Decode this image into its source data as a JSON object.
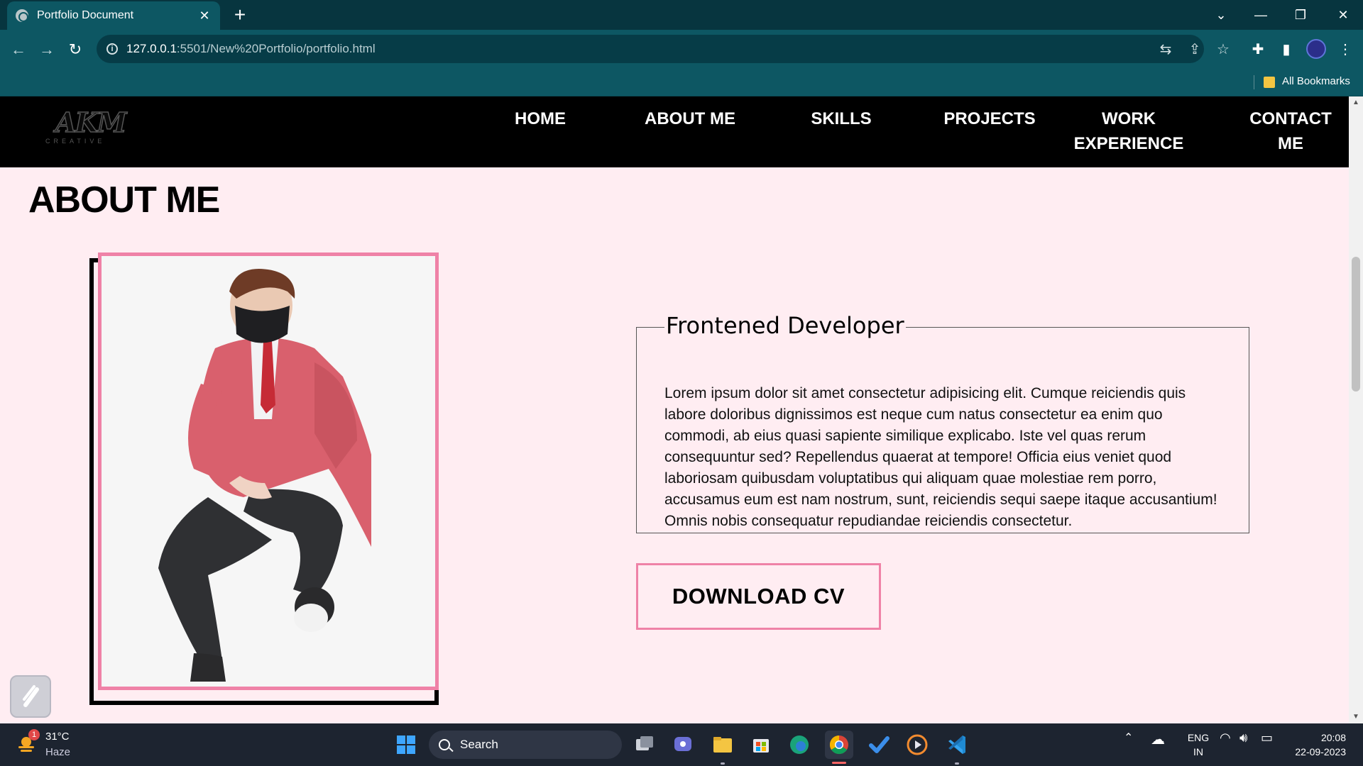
{
  "browser": {
    "tab_title": "Portfolio Document",
    "url_host": "127.0.0.1",
    "url_path": ":5501/New%20Portfolio/portfolio.html",
    "bookmarks_label": "All Bookmarks"
  },
  "site": {
    "logo_text": "AKM",
    "logo_sub": "CREATIVE",
    "nav": [
      {
        "label": "HOME"
      },
      {
        "label": "ABOUT ME"
      },
      {
        "label": "SKILLS"
      },
      {
        "label": "PROJECTS"
      },
      {
        "label": "WORK EXPERIENCE"
      },
      {
        "label": "CONTACT ME"
      }
    ],
    "section_title": "ABOUT ME",
    "role_title": "Frontened Developer",
    "about_text": "Lorem ipsum dolor sit amet consectetur adipisicing elit. Cumque reiciendis quis labore doloribus dignissimos est neque cum natus consectetur ea enim quo commodi, ab eius quasi sapiente similique explicabo. Iste vel quas rerum consequuntur sed? Repellendus quaerat at tempore! Officia eius veniet quod laboriosam quibusdam voluptatibus qui aliquam quae molestiae rem porro, accusamus eum est nam nostrum, sunt, reiciendis sequi saepe itaque accusantium! Omnis nobis consequatur repudiandae reiciendis consectetur.",
    "download_label": "DOWNLOAD CV",
    "accent_color": "#ef82a7",
    "background_color": "#ffedf2"
  },
  "taskbar": {
    "weather_badge": "1",
    "weather_temp": "31°C",
    "weather_desc": "Haze",
    "search_label": "Search",
    "lang_primary": "ENG",
    "lang_secondary": "IN",
    "time": "20:08",
    "date": "22-09-2023"
  }
}
